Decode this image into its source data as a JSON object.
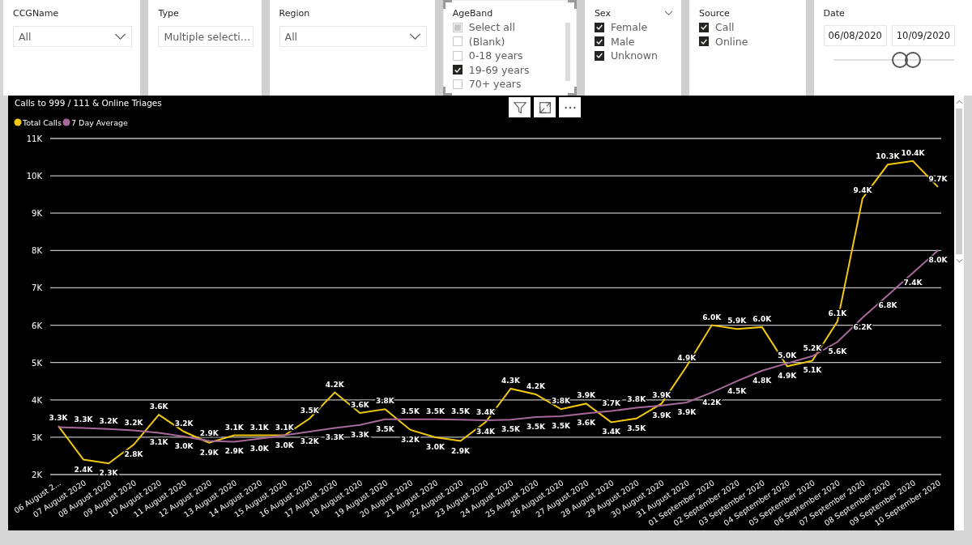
{
  "slicers": [
    {
      "kind": "dropdown",
      "title": "CCGName",
      "value": "All"
    },
    {
      "kind": "dropdown",
      "title": "Type",
      "value": "Multiple selecti…"
    },
    {
      "kind": "dropdown",
      "title": "Region",
      "value": "All"
    },
    {
      "kind": "list",
      "title": "AgeBand",
      "selected": true,
      "items": [
        {
          "label": "Select all",
          "checked": false,
          "partial": true
        },
        {
          "label": "(Blank)",
          "checked": false
        },
        {
          "label": "0-18 years",
          "checked": false
        },
        {
          "label": "19-69 years",
          "checked": true
        },
        {
          "label": "70+ years",
          "checked": false
        }
      ]
    },
    {
      "kind": "list",
      "title": "Sex",
      "selected": false,
      "collapsible": true,
      "items": [
        {
          "label": "Female",
          "checked": true
        },
        {
          "label": "Male",
          "checked": true
        },
        {
          "label": "Unknown",
          "checked": true
        }
      ]
    },
    {
      "kind": "list",
      "title": "Source",
      "selected": false,
      "items": [
        {
          "label": "Call",
          "checked": true
        },
        {
          "label": "Online",
          "checked": true
        }
      ]
    },
    {
      "kind": "date",
      "title": "Date",
      "from": "06/08/2020",
      "to": "10/09/2020",
      "handles": [
        {
          "level": 0.55
        },
        {
          "level": 0.66
        }
      ]
    }
  ],
  "chart": {
    "chart_data": {
      "type": "line",
      "title": "Calls to 999 / 111 & Online Triages",
      "grid": true,
      "legend": true,
      "categories": [
        "06 August 2...",
        "07 August 2020",
        "08 August 2020",
        "09 August 2020",
        "10 August 2020",
        "11 August 2020",
        "12 August 2020",
        "13 August 2020",
        "14 August 2020",
        "15 August 2020",
        "16 August 2020",
        "17 August 2020",
        "18 August 2020",
        "19 August 2020",
        "20 August 2020",
        "21 August 2020",
        "22 August 2020",
        "23 August 2020",
        "24 August 2020",
        "25 August 2020",
        "26 August 2020",
        "27 August 2020",
        "28 August 2020",
        "29 August 2020",
        "30 August 2020",
        "31 August 2020",
        "01 September 2020",
        "02 September 2020",
        "03 September 2020",
        "04 September 2020",
        "05 September 2020",
        "06 September 2020",
        "07 September 2020",
        "08 September 2020",
        "09 September 2020",
        "10 September 2020"
      ],
      "series": [
        {
          "name": "Total Calls",
          "color": "#f2c80f",
          "values": [
            3300,
            2400,
            2300,
            2800,
            3600,
            3150,
            2850,
            3050,
            3050,
            3050,
            3500,
            4200,
            3650,
            3750,
            3200,
            3000,
            2900,
            3400,
            4300,
            4150,
            3750,
            3900,
            3400,
            3500,
            3900,
            4900,
            6000,
            5900,
            5950,
            4900,
            5050,
            6100,
            9400,
            10300,
            10400,
            9700
          ]
        },
        {
          "name": "7 Day Average",
          "color": "#a66999",
          "values": [
            3270,
            3250,
            3220,
            3180,
            3120,
            3020,
            2900,
            2880,
            2960,
            3050,
            3150,
            3250,
            3330,
            3480,
            3480,
            3480,
            3470,
            3450,
            3470,
            3540,
            3560,
            3640,
            3700,
            3790,
            3850,
            3930,
            4200,
            4500,
            4780,
            4980,
            5170,
            5550,
            6200,
            6800,
            7400,
            8000
          ]
        }
      ],
      "value_labels": [
        [
          "3.3K",
          "2.4K",
          "2.3K",
          "2.8K",
          "3.6K",
          "3.2K",
          "2.9K",
          "3.1K",
          "3.1K",
          "3.1K",
          "3.5K",
          "4.2K",
          "3.6K",
          "3.8K",
          "3.2K",
          "3.0K",
          "2.9K",
          "3.4K",
          "4.3K",
          "4.2K",
          "3.8K",
          "3.9K",
          "3.4K",
          "3.5K",
          "3.9K",
          "4.9K",
          "6.0K",
          "5.9K",
          "6.0K",
          "4.9K",
          "5.1K",
          "6.1K",
          "9.4K",
          "10.3K",
          "10.4K",
          "9.7K"
        ],
        [
          null,
          "3.3K",
          "3.2K",
          "3.2K",
          "3.1K",
          "3.0K",
          "2.9K",
          "2.9K",
          "3.0K",
          "3.0K",
          "3.2K",
          "3.3K",
          "3.3K",
          "3.5K",
          "3.5K",
          "3.5K",
          "3.5K",
          "3.4K",
          "3.5K",
          "3.5K",
          "3.5K",
          "3.6K",
          "3.7K",
          "3.8K",
          "3.9K",
          "3.9K",
          "4.2K",
          "4.5K",
          "4.8K",
          "5.0K",
          "5.2K",
          "5.6K",
          "6.2K",
          "6.8K",
          "7.4K",
          "8.0K"
        ]
      ],
      "ylim": [
        2000,
        11000
      ],
      "yticks": [
        {
          "value": 2000,
          "label": "2K"
        },
        {
          "value": 3000,
          "label": "3K"
        },
        {
          "value": 4000,
          "label": "4K"
        },
        {
          "value": 5000,
          "label": "5K"
        },
        {
          "value": 6000,
          "label": "6K"
        },
        {
          "value": 7000,
          "label": "7K"
        },
        {
          "value": 8000,
          "label": "8K"
        },
        {
          "value": 9000,
          "label": "9K"
        },
        {
          "value": 10000,
          "label": "10K"
        },
        {
          "value": 11000,
          "label": "11K"
        }
      ]
    }
  }
}
